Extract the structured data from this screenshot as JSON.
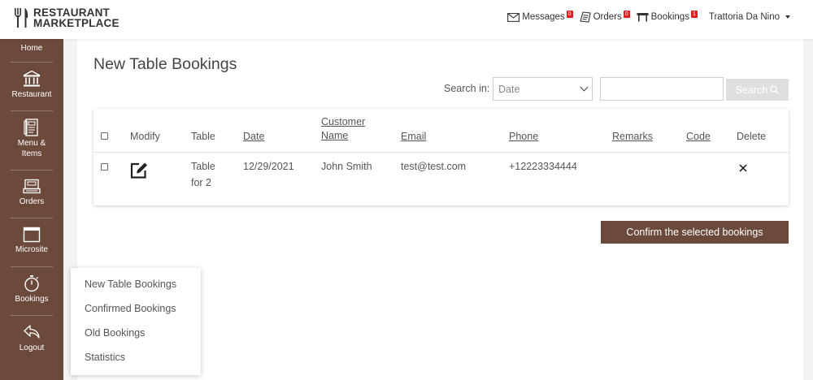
{
  "brand": {
    "line1": "RESTAURANT",
    "line2": "MARKETPLACE"
  },
  "topnav": {
    "messages": {
      "label": "Messages",
      "count": "0"
    },
    "orders": {
      "label": "Orders",
      "count": "0"
    },
    "bookings": {
      "label": "Bookings",
      "count": "1"
    },
    "user": "Trattoria Da Nino"
  },
  "sidebar": {
    "home": "Home",
    "restaurant": "Restaurant",
    "menu_items": [
      "Menu &",
      "Items"
    ],
    "orders": "Orders",
    "microsite": "Microsite",
    "bookings": "Bookings",
    "logout": "Logout"
  },
  "main": {
    "title": "New Table Bookings",
    "search_label": "Search in:",
    "search_field": "Date",
    "search_query": "",
    "search_button": "Search",
    "columns": {
      "modify": "Modify",
      "table": "Table",
      "date": "Date",
      "customer_name": [
        "Customer",
        "Name"
      ],
      "email": "Email",
      "phone": "Phone",
      "remarks": "Remarks",
      "code": "Code",
      "delete": "Delete"
    },
    "rows": [
      {
        "table": [
          "Table",
          "for 2"
        ],
        "date": "12/29/2021",
        "customer_name": "John Smith",
        "email": "test@test.com",
        "phone": "+12223334444",
        "remarks": "",
        "code": ""
      }
    ],
    "confirm_button": "Confirm the selected bookings"
  },
  "bookings_menu": [
    "New Table Bookings",
    "Confirmed Bookings",
    "Old Bookings",
    "Statistics"
  ],
  "colors": {
    "brand_brown": "#6b4a3c",
    "badge_red": "#e02020"
  }
}
